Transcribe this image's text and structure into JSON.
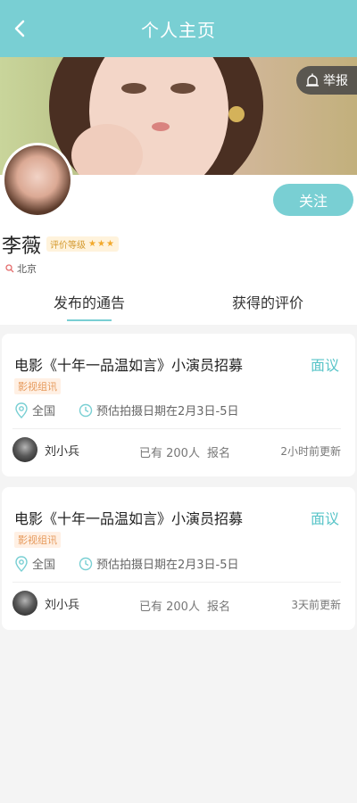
{
  "header": {
    "title": "个人主页",
    "back_icon": "chevron-left-icon"
  },
  "cover": {
    "report_label": "举报",
    "report_icon": "alarm-icon"
  },
  "profile": {
    "name": "李薇",
    "rating_label": "评价等级",
    "stars": 3,
    "location": "北京",
    "follow_label": "关注"
  },
  "tabs": [
    {
      "label": "发布的通告",
      "active": true
    },
    {
      "label": "获得的评价",
      "active": false
    }
  ],
  "posts": [
    {
      "title": "电影《十年一品温如言》小演员招募",
      "price": "面议",
      "tag": "影视组讯",
      "location": "全国",
      "date": "预估拍摄日期在2月3日-5日",
      "poster": "刘小兵",
      "count": "已有 200人",
      "count_suffix": "报名",
      "updated": "2小时前更新"
    },
    {
      "title": "电影《十年一品温如言》小演员招募",
      "price": "面议",
      "tag": "影视组讯",
      "location": "全国",
      "date": "预估拍摄日期在2月3日-5日",
      "poster": "刘小兵",
      "count": "已有 200人",
      "count_suffix": "报名",
      "updated": "3天前更新"
    }
  ],
  "colors": {
    "accent": "#79cfd3",
    "price": "#58c4c8",
    "tag_text": "#e69a5c",
    "tag_bg": "#fff0e4",
    "star": "#f2a92c"
  }
}
